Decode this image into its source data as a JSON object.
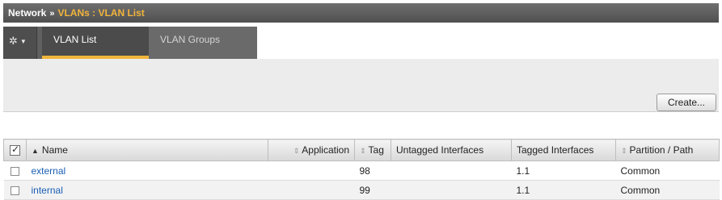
{
  "breadcrumb": {
    "section": "Network",
    "separator": "»",
    "current": "VLANs : VLAN List"
  },
  "tabs": [
    {
      "label": "VLAN List",
      "active": true
    },
    {
      "label": "VLAN Groups",
      "active": false
    }
  ],
  "toolbar": {
    "create_label": "Create...",
    "gear_icon": "gear-icon"
  },
  "table": {
    "columns": [
      "Name",
      "Application",
      "Tag",
      "Untagged Interfaces",
      "Tagged Interfaces",
      "Partition / Path"
    ],
    "rows": [
      {
        "name": "external",
        "application": "",
        "tag": "98",
        "untagged": "",
        "tagged": "1.1",
        "partition": "Common"
      },
      {
        "name": "internal",
        "application": "",
        "tag": "99",
        "untagged": "",
        "tagged": "1.1",
        "partition": "Common"
      }
    ]
  },
  "colors": {
    "accent": "#f1b43c",
    "link": "#1a5fb4",
    "header_bar": "#5a5a5a"
  }
}
